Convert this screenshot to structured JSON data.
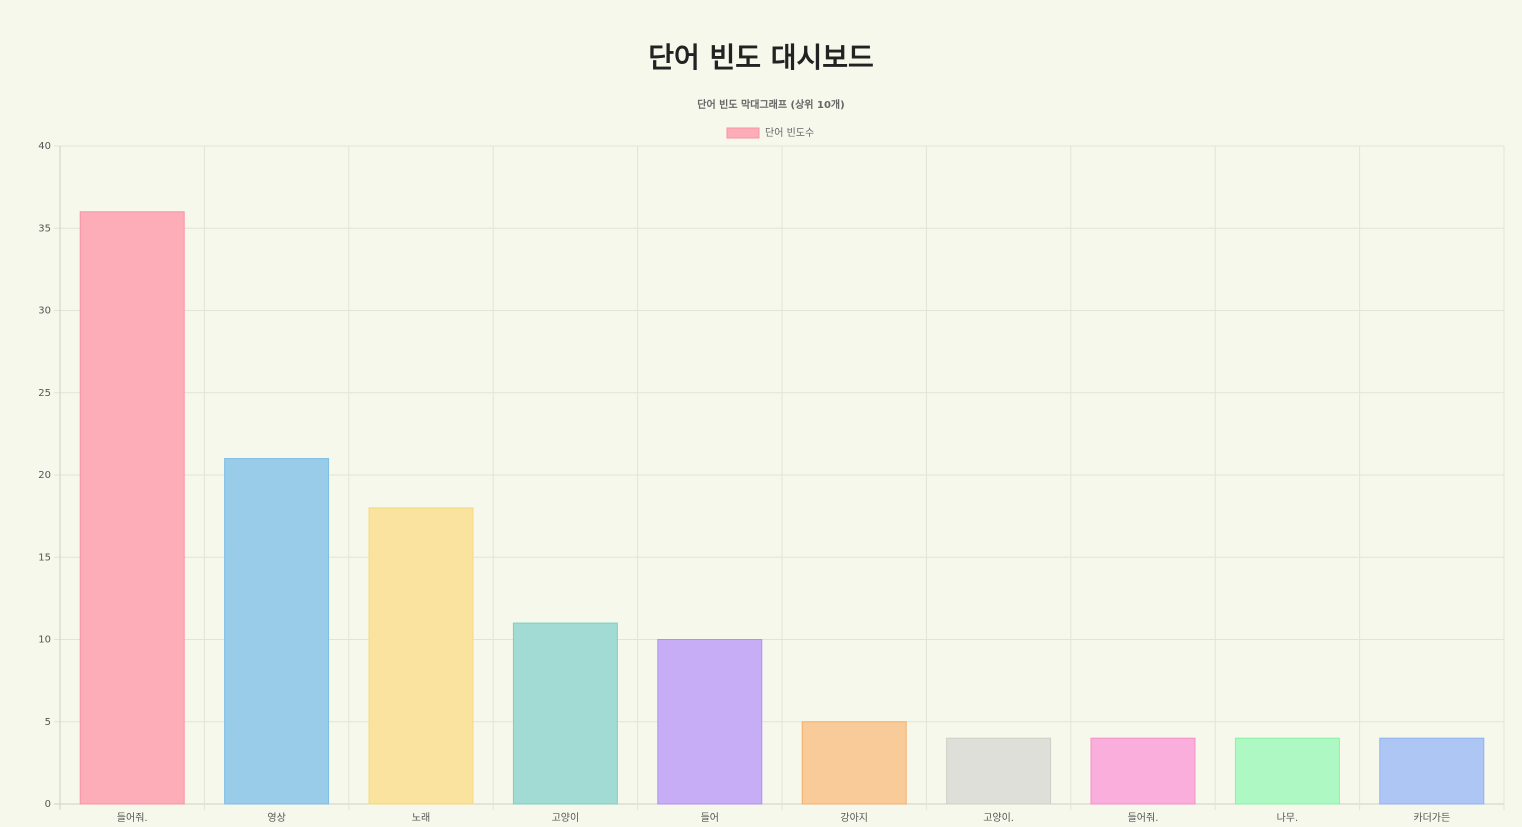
{
  "page": {
    "title": "단어 빈도 대시보드"
  },
  "chart_data": {
    "type": "bar",
    "title": "단어 빈도 막대그래프 (상위 10개)",
    "xlabel": "",
    "ylabel": "",
    "ylim": [
      0,
      40
    ],
    "ytick_step": 5,
    "grid": true,
    "legend_position": "top",
    "categories": [
      "들어줘.",
      "영상",
      "노래",
      "고양이",
      "들어",
      "강아지",
      "고양이.",
      "들어줘.",
      "나무.",
      "카더가든"
    ],
    "series": [
      {
        "name": "단어 빈도수",
        "values": [
          36,
          21,
          18,
          11,
          10,
          5,
          4,
          4,
          4,
          4
        ]
      }
    ],
    "bar_colors": [
      "#fcadb8",
      "#98cce9",
      "#f9e39e",
      "#a1dbd3",
      "#c7adf5",
      "#f9cb98",
      "#dfdfd9",
      "#f9aedb",
      "#aef9c3",
      "#aec6f4"
    ],
    "bar_border_colors": [
      "#f893a3",
      "#7fbde6",
      "#f3d97c",
      "#7fcfc3",
      "#b190f5",
      "#f5ae6a",
      "#cfcfc8",
      "#f58fc9",
      "#87f3a3",
      "#8eb1f2"
    ],
    "legend_color": "#fcadb8",
    "legend_border_color": "#f893a3"
  }
}
